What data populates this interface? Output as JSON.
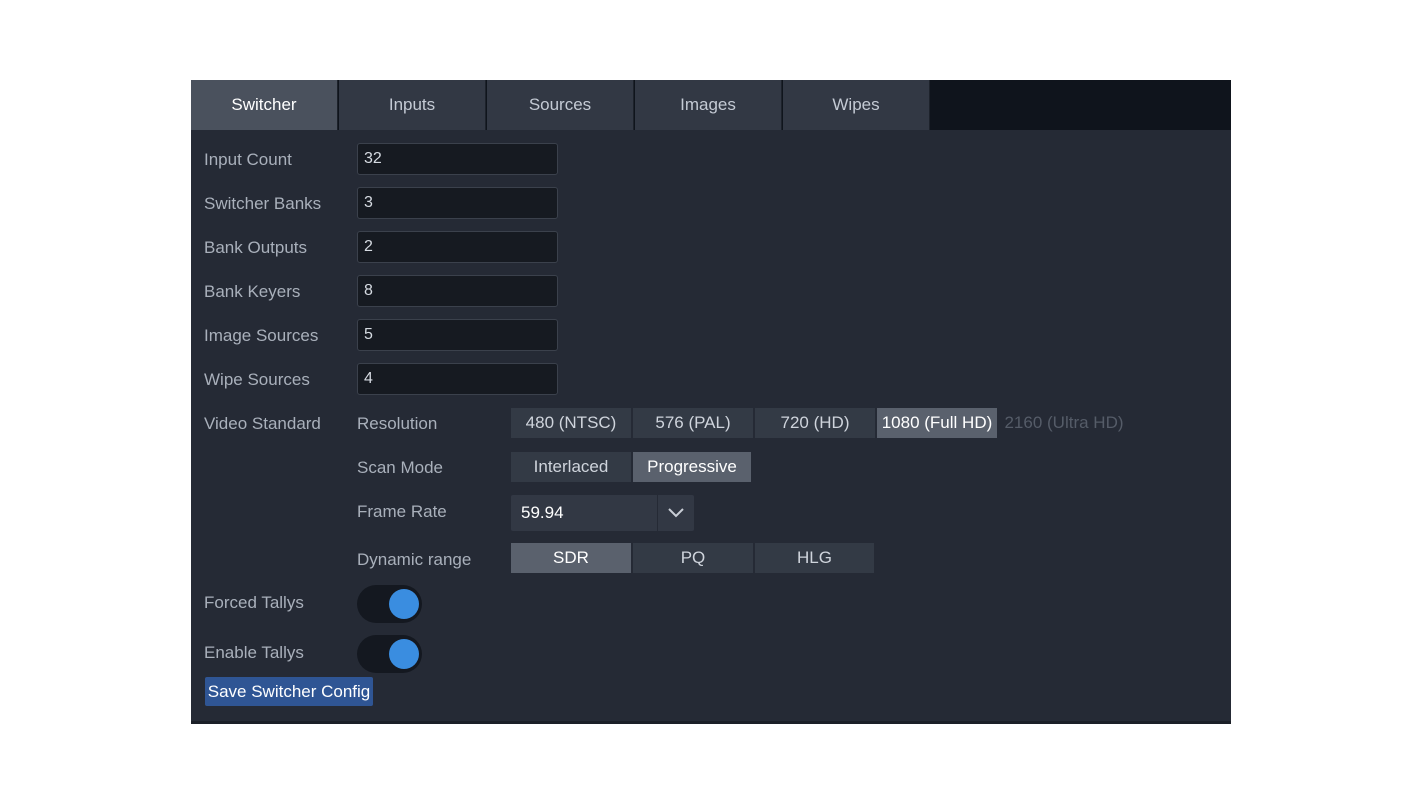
{
  "tabs": [
    {
      "label": "Switcher",
      "active": true
    },
    {
      "label": "Inputs",
      "active": false
    },
    {
      "label": "Sources",
      "active": false
    },
    {
      "label": "Images",
      "active": false
    },
    {
      "label": "Wipes",
      "active": false
    }
  ],
  "fields": {
    "input_count": {
      "label": "Input Count",
      "value": "32"
    },
    "switcher_banks": {
      "label": "Switcher Banks",
      "value": "3"
    },
    "bank_outputs": {
      "label": "Bank Outputs",
      "value": "2"
    },
    "bank_keyers": {
      "label": "Bank Keyers",
      "value": "8"
    },
    "image_sources": {
      "label": "Image Sources",
      "value": "5"
    },
    "wipe_sources": {
      "label": "Wipe Sources",
      "value": "4"
    }
  },
  "video_standard": {
    "label": "Video Standard",
    "resolution": {
      "label": "Resolution",
      "options": [
        "480 (NTSC)",
        "576 (PAL)",
        "720 (HD)",
        "1080 (Full HD)",
        "2160 (Ultra HD)"
      ],
      "selected": "1080 (Full HD)",
      "disabled": [
        "2160 (Ultra HD)"
      ]
    },
    "scan_mode": {
      "label": "Scan Mode",
      "options": [
        "Interlaced",
        "Progressive"
      ],
      "selected": "Progressive"
    },
    "frame_rate": {
      "label": "Frame Rate",
      "value": "59.94",
      "icon": "chevron-down-icon"
    },
    "dynamic_range": {
      "label": "Dynamic range",
      "options": [
        "SDR",
        "PQ",
        "HLG"
      ],
      "selected": "SDR"
    }
  },
  "toggles": {
    "forced_tallys": {
      "label": "Forced Tallys",
      "on": true
    },
    "enable_tallys": {
      "label": "Enable Tallys",
      "on": true
    }
  },
  "save_button": "Save Switcher Config",
  "colors": {
    "panel_bg": "#252a35",
    "accent": "#3a8de0",
    "button_blue": "#2f5594"
  }
}
